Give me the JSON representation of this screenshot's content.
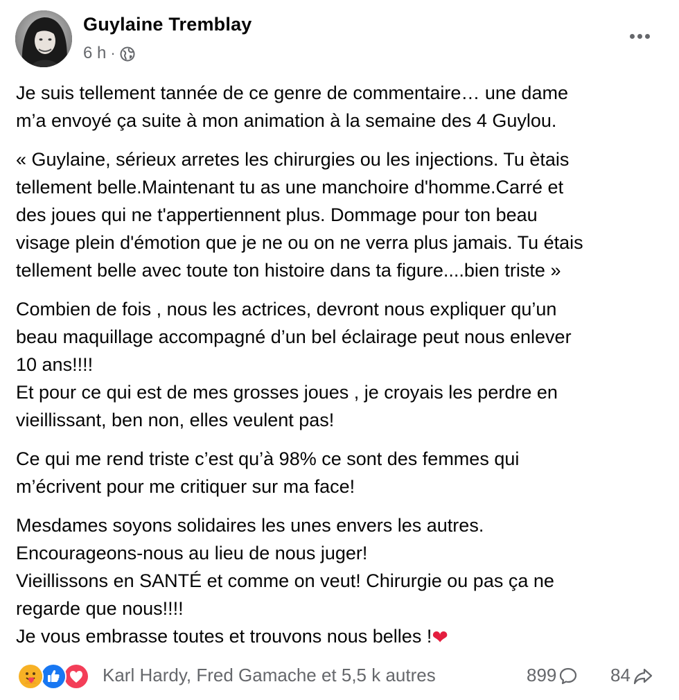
{
  "post": {
    "author": "Guylaine Tremblay",
    "time": "6 h",
    "separator": "·",
    "visibility_icon": "globe-icon",
    "more_icon": "more-options-icon",
    "paragraphs": [
      {
        "lines": [
          "Je suis tellement tannée de ce genre de commentaire… une dame",
          "m’a envoyé ça suite à mon animation à la semaine des 4 Guylou."
        ]
      },
      {
        "lines": [
          "« Guylaine, sérieux arretes les chirurgies ou les injections. Tu ètais",
          "tellement belle.Maintenant tu as une manchoire d'homme.Carré et",
          "des joues qui ne t'appertiennent plus. Dommage pour ton beau",
          "visage plein d'émotion que je ne ou on ne verra plus jamais. Tu étais",
          "tellement belle avec toute ton histoire dans ta figure....bien triste »"
        ]
      },
      {
        "lines": [
          "Combien de fois , nous les actrices, devront nous expliquer qu’un",
          "beau maquillage accompagné d’un bel éclairage peut nous enlever",
          "10 ans!!!!",
          "Et pour ce qui est de mes grosses joues , je croyais les perdre en",
          "vieillissant, ben non, elles veulent pas!"
        ]
      },
      {
        "lines": [
          "Ce qui me rend triste c’est qu’à 98% ce sont des femmes qui",
          "m’écrivent pour me critiquer sur ma face!"
        ]
      },
      {
        "lines": [
          "Mesdames soyons solidaires les unes envers les autres.",
          "Encourageons-nous au lieu de nous juger!",
          "Vieillissons en SANTÉ et comme on veut! Chirurgie ou pas ça ne",
          "regarde que nous!!!!",
          "Je vous embrasse toutes et trouvons nous belles !"
        ],
        "trailing_emoji": "❤"
      }
    ],
    "reactions": {
      "icons": [
        "care-reaction-icon",
        "like-reaction-icon",
        "love-reaction-icon"
      ],
      "summary": "Karl Hardy, Fred Gamache et 5,5 k autres"
    },
    "comments_count": "899",
    "comment_icon": "comment-icon",
    "shares_count": "84",
    "share_icon": "share-icon"
  },
  "colors": {
    "text_primary": "#050505",
    "text_secondary": "#65676b",
    "like_blue": "#1877f2",
    "love_red": "#f33e58",
    "care_yellow": "#f7b125",
    "heart_red": "#e41e3f"
  }
}
